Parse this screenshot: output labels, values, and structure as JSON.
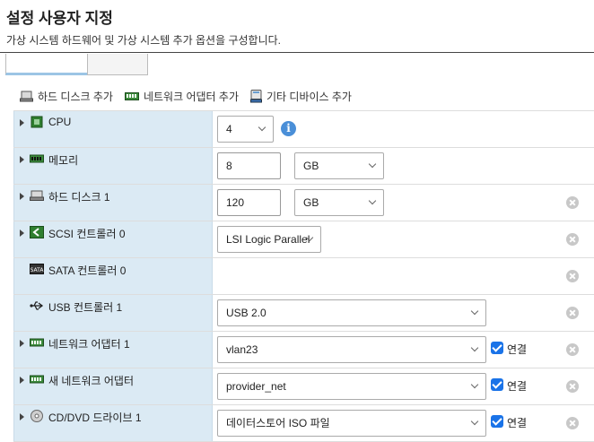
{
  "header": {
    "title": "설정 사용자 지정",
    "description": "가상 시스템 하드웨어 및 가상 시스템 추가 옵션을 구성합니다."
  },
  "toolbar": {
    "add_hard_disk": "하드 디스크 추가",
    "add_network_adapter": "네트워크 어댑터 추가",
    "add_other_device": "기타 디바이스 추가"
  },
  "devices": {
    "cpu": {
      "label": "CPU",
      "value": "4"
    },
    "memory": {
      "label": "메모리",
      "value": "8",
      "unit": "GB"
    },
    "hard_disk_1": {
      "label": "하드 디스크 1",
      "value": "120",
      "unit": "GB"
    },
    "scsi": {
      "label": "SCSI 컨트롤러 0",
      "value": "LSI Logic Parallel"
    },
    "sata": {
      "label": "SATA 컨트롤러 0"
    },
    "usb": {
      "label": "USB 컨트롤러 1",
      "value": "USB 2.0"
    },
    "network_adapter_1": {
      "label": "네트워크 어댑터 1",
      "value": "vlan23",
      "connect_label": "연결",
      "connected": true
    },
    "new_network_adapter": {
      "label": "새 네트워크 어댑터",
      "value": "provider_net",
      "connect_label": "연결",
      "connected": true
    },
    "cd_dvd_1": {
      "label": "CD/DVD 드라이브 1",
      "value": "데이터스토어 ISO 파일",
      "connect_label": "연결",
      "connected": true
    }
  },
  "colors": {
    "label_column_bg": "#dbeaf4",
    "checkbox": "#1a73e8",
    "info": "#4a8fd8"
  }
}
